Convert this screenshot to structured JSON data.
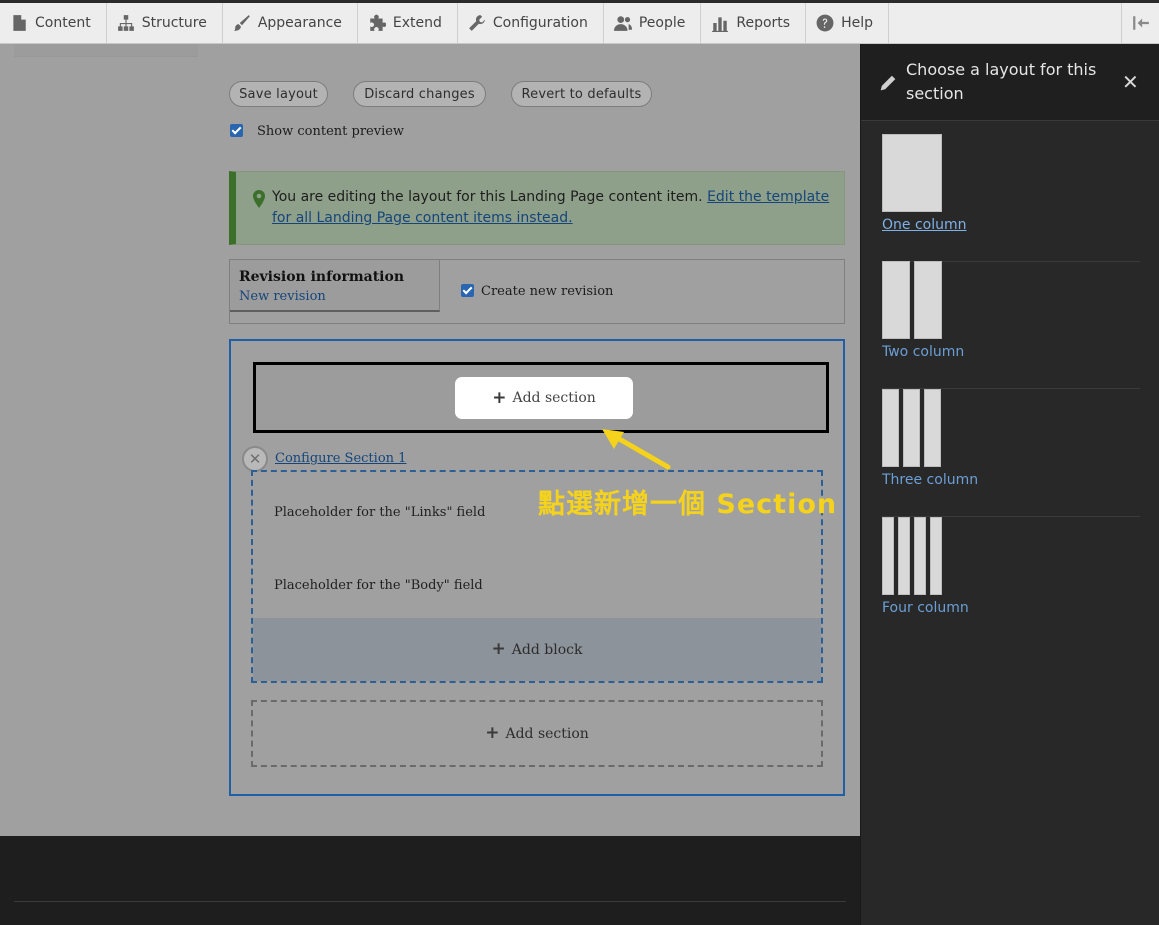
{
  "toolbar": {
    "items": [
      {
        "label": "Content",
        "icon": "file-icon"
      },
      {
        "label": "Structure",
        "icon": "sitemap-icon"
      },
      {
        "label": "Appearance",
        "icon": "brush-icon"
      },
      {
        "label": "Extend",
        "icon": "puzzle-icon"
      },
      {
        "label": "Configuration",
        "icon": "wrench-icon"
      },
      {
        "label": "People",
        "icon": "people-icon"
      },
      {
        "label": "Reports",
        "icon": "bar-chart-icon"
      },
      {
        "label": "Help",
        "icon": "help-icon"
      }
    ],
    "toggle_icon": "collapse-sidebar-icon"
  },
  "actions": {
    "save": "Save layout",
    "discard": "Discard changes",
    "revert": "Revert to defaults"
  },
  "preview": {
    "label": "Show content preview",
    "checked": true
  },
  "message": {
    "text": "You are editing the layout for this Landing Page content item. ",
    "link": "Edit the template for all Landing Page content items instead."
  },
  "revision": {
    "title": "Revision information",
    "summary": "New revision",
    "create_label": "Create new revision",
    "create_checked": true
  },
  "builder": {
    "add_section": "Add section",
    "configure_section": "Configure Section 1",
    "placeholders": [
      "Placeholder for the \"Links\" field",
      "Placeholder for the \"Body\" field"
    ],
    "add_block": "Add block",
    "add_section_bottom": "Add section"
  },
  "annotation": {
    "text": "點選新增一個 Section",
    "color": "#f5d21b"
  },
  "panel": {
    "title": "Choose a layout for this section",
    "close_icon": "close-icon",
    "layouts": [
      {
        "label": "One column",
        "columns": 1
      },
      {
        "label": "Two column",
        "columns": 2
      },
      {
        "label": "Three column",
        "columns": 3
      },
      {
        "label": "Four column",
        "columns": 4
      }
    ]
  },
  "colors": {
    "accent": "#1f5fa8",
    "link": "#15457a",
    "panel_bg": "#282828"
  }
}
